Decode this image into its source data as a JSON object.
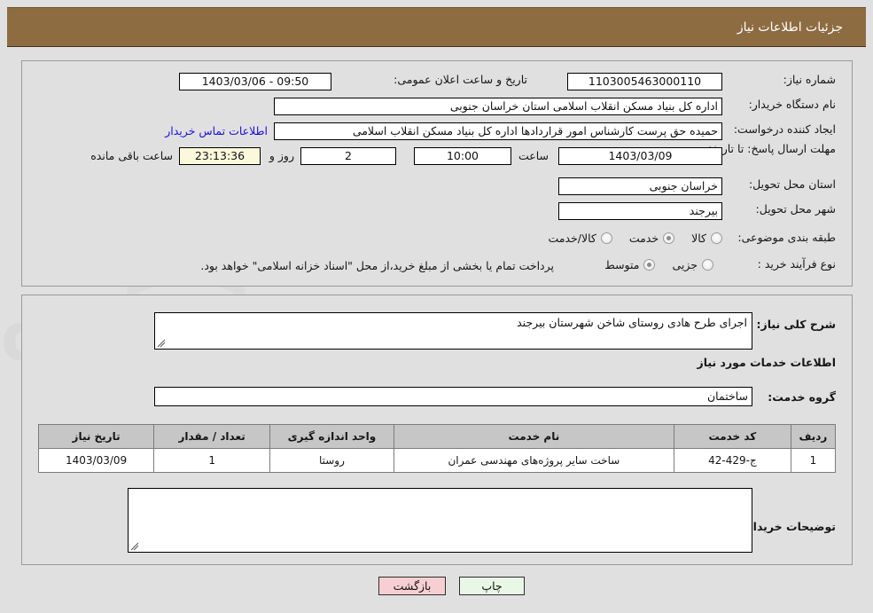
{
  "header": {
    "title": "جزئیات اطلاعات نیاز"
  },
  "top_panel": {
    "need_number": {
      "label": "شماره نیاز:",
      "value": "1103005463000110"
    },
    "public_announce": {
      "label": "تاریخ و ساعت اعلان عمومی:",
      "value": "1403/03/06 - 09:50"
    },
    "buyer_org": {
      "label": "نام دستگاه خریدار:",
      "value": "اداره کل بنیاد مسکن انقلاب اسلامی استان خراسان جنوبی"
    },
    "requester": {
      "label": "ایجاد کننده درخواست:",
      "value": "حمیده حق پرست کارشناس امور قراردادها اداره کل بنیاد مسکن انقلاب اسلامی"
    },
    "buyer_contact_link": "اطلاعات تماس خریدار",
    "deadline": {
      "label": "مهلت ارسال پاسخ: تا تاریخ:",
      "date": "1403/03/09",
      "time_label": "ساعت",
      "time": "10:00",
      "days": "2",
      "days_label": "روز و",
      "countdown": "23:13:36",
      "remaining_label": "ساعت باقی مانده"
    },
    "province": {
      "label": "استان محل تحویل:",
      "value": "خراسان جنوبی"
    },
    "city": {
      "label": "شهر محل تحویل:",
      "value": "بیرجند"
    },
    "category": {
      "label": "طبقه بندی موضوعی:",
      "options": [
        "کالا",
        "خدمت",
        "کالا/خدمت"
      ],
      "selected": "خدمت"
    },
    "purchase_type": {
      "label": "نوع فرآیند خرید :",
      "options": [
        "جزیی",
        "متوسط"
      ],
      "selected": "متوسط",
      "note": "پرداخت تمام یا بخشی از مبلغ خرید،از محل \"اسناد خزانه اسلامی\" خواهد بود."
    }
  },
  "mid_panel": {
    "general_desc": {
      "label": "شرح کلی نیاز:",
      "value": "اجرای طرح هادی روستای شاخن شهرستان بیرجند"
    },
    "services_heading": "اطلاعات خدمات مورد نیاز",
    "service_group": {
      "label": "گروه خدمت:",
      "value": "ساختمان"
    },
    "table": {
      "headers": [
        "ردیف",
        "کد خدمت",
        "نام خدمت",
        "واحد اندازه گیری",
        "تعداد / مقدار",
        "تاریخ نیاز"
      ],
      "rows": [
        [
          "1",
          "ج-429-42",
          "ساخت سایر پروژه‌های مهندسی عمران",
          "روستا",
          "1",
          "1403/03/09"
        ]
      ]
    },
    "buyer_notes": {
      "label": "توضیحات خریدار:",
      "value": ""
    }
  },
  "footer": {
    "back_button": "بازگشت",
    "print_button": "چاپ"
  },
  "colors": {
    "header_bg": "#8d6c41",
    "page_bg": "#e0e0e0",
    "link": "#1a12d8",
    "countdown_bg": "#fbf8dc",
    "back_btn_bg": "#f7cfd2",
    "print_btn_bg": "#e9f7e6",
    "table_header_bg": "#c6c6c6"
  },
  "watermark": {
    "text": "AnaTender.net"
  }
}
